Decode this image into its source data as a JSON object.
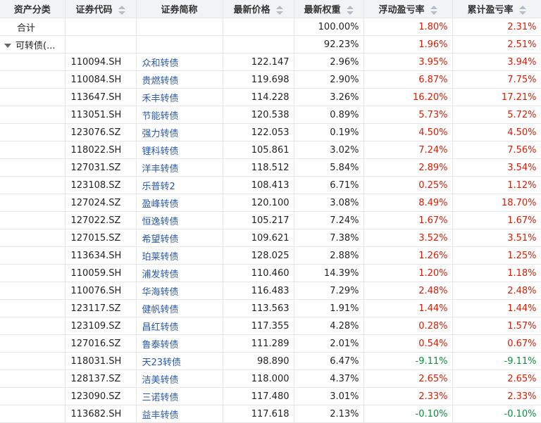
{
  "headers": {
    "asset_class": "资产分类",
    "code": "证券代码",
    "name": "证券简称",
    "price": "最新价格",
    "weight": "最新权重",
    "float_pl": "浮动盈亏率",
    "cum_pl": "累计盈亏率"
  },
  "summary": {
    "label": "合计",
    "weight": "100.00%",
    "float_pl": "1.80%",
    "cum_pl": "2.31%"
  },
  "group": {
    "label": "可转债(...",
    "weight": "92.23%",
    "float_pl": "1.96%",
    "cum_pl": "2.51%"
  },
  "rows": [
    {
      "code": "110094.SH",
      "name": "众和转债",
      "price": "122.147",
      "weight": "2.96%",
      "float_pl": "3.95%",
      "cum_pl": "3.94%"
    },
    {
      "code": "110084.SH",
      "name": "贵燃转债",
      "price": "119.698",
      "weight": "2.90%",
      "float_pl": "6.87%",
      "cum_pl": "7.75%"
    },
    {
      "code": "113647.SH",
      "name": "禾丰转债",
      "price": "114.228",
      "weight": "3.26%",
      "float_pl": "16.20%",
      "cum_pl": "17.21%"
    },
    {
      "code": "113051.SH",
      "name": "节能转债",
      "price": "120.538",
      "weight": "0.89%",
      "float_pl": "5.73%",
      "cum_pl": "5.72%"
    },
    {
      "code": "123076.SZ",
      "name": "强力转债",
      "price": "122.053",
      "weight": "0.19%",
      "float_pl": "4.50%",
      "cum_pl": "4.50%"
    },
    {
      "code": "118022.SH",
      "name": "锂科转债",
      "price": "105.861",
      "weight": "3.02%",
      "float_pl": "7.24%",
      "cum_pl": "7.56%"
    },
    {
      "code": "127031.SZ",
      "name": "洋丰转债",
      "price": "118.512",
      "weight": "5.84%",
      "float_pl": "2.89%",
      "cum_pl": "3.54%"
    },
    {
      "code": "123108.SZ",
      "name": "乐普转2",
      "price": "108.413",
      "weight": "6.71%",
      "float_pl": "0.25%",
      "cum_pl": "1.12%"
    },
    {
      "code": "127024.SZ",
      "name": "盈峰转债",
      "price": "120.100",
      "weight": "3.08%",
      "float_pl": "8.49%",
      "cum_pl": "18.70%"
    },
    {
      "code": "127022.SZ",
      "name": "恒逸转债",
      "price": "105.217",
      "weight": "7.24%",
      "float_pl": "1.67%",
      "cum_pl": "1.67%"
    },
    {
      "code": "127015.SZ",
      "name": "希望转债",
      "price": "109.621",
      "weight": "7.38%",
      "float_pl": "3.52%",
      "cum_pl": "3.51%"
    },
    {
      "code": "113634.SH",
      "name": "珀莱转债",
      "price": "128.025",
      "weight": "2.88%",
      "float_pl": "1.26%",
      "cum_pl": "1.25%"
    },
    {
      "code": "110059.SH",
      "name": "浦发转债",
      "price": "110.460",
      "weight": "14.39%",
      "float_pl": "1.20%",
      "cum_pl": "1.18%"
    },
    {
      "code": "110076.SH",
      "name": "华海转债",
      "price": "116.483",
      "weight": "7.29%",
      "float_pl": "2.48%",
      "cum_pl": "2.48%"
    },
    {
      "code": "123117.SZ",
      "name": "健帆转债",
      "price": "113.563",
      "weight": "1.91%",
      "float_pl": "1.44%",
      "cum_pl": "1.44%"
    },
    {
      "code": "123109.SZ",
      "name": "昌红转债",
      "price": "117.355",
      "weight": "4.28%",
      "float_pl": "0.28%",
      "cum_pl": "1.57%"
    },
    {
      "code": "127016.SZ",
      "name": "鲁泰转债",
      "price": "111.289",
      "weight": "2.01%",
      "float_pl": "0.54%",
      "cum_pl": "0.67%"
    },
    {
      "code": "118031.SH",
      "name": "天23转债",
      "price": "98.890",
      "weight": "6.47%",
      "float_pl": "-9.11%",
      "cum_pl": "-9.11%"
    },
    {
      "code": "128137.SZ",
      "name": "洁美转债",
      "price": "118.000",
      "weight": "4.37%",
      "float_pl": "2.65%",
      "cum_pl": "2.65%"
    },
    {
      "code": "123090.SZ",
      "name": "三诺转债",
      "price": "117.480",
      "weight": "3.01%",
      "float_pl": "2.33%",
      "cum_pl": "2.33%"
    },
    {
      "code": "113682.SH",
      "name": "益丰转债",
      "price": "117.618",
      "weight": "2.13%",
      "float_pl": "-0.10%",
      "cum_pl": "-0.10%"
    }
  ],
  "colors": {
    "gain": "#d81e06",
    "loss": "#0a8f3c",
    "link": "#2b5aa8"
  }
}
